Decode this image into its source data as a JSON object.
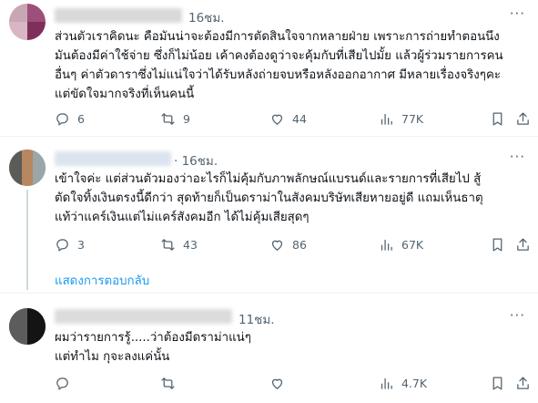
{
  "tweets": [
    {
      "time": "16ชม.",
      "more": "···",
      "lines": [
        "ส่วนตัวเราคิดนะ คือมันน่าจะต้องมีการตัดสินใจจากหลายฝ่าย เพราะการถ่ายทำตอนนึง",
        "มันต้องมีค่าใช้จ่าย ซึ่งก็ไม่น้อย เค้าคงต้องดูว่าจะคุ้มกับที่เสียไปมั้ย แล้วผู้ร่วมรายการคน",
        "อื่นๆ ค่าตัวดาราซึ่งไม่แน่ใจว่าได้รับหลังถ่ายจบหรือหลังออกอากาศ มีหลายเรื่องจริงๆคะ",
        "แต่ขัดใจมากจริงที่เห็นคนนี้"
      ],
      "replies": "6",
      "reposts": "9",
      "likes": "44",
      "views": "77K"
    },
    {
      "time": "· 16ชม.",
      "more": "···",
      "lines": [
        "เข้าใจค่ะ แต่ส่วนตัวมองว่าอะไรก็ไม่คุ้มกับภาพลักษณ์แบรนด์และรายการที่เสียไป สู้",
        "ตัดใจทิ้งเงินตรงนี้ดีกว่า สุดท้ายก็เป็นดราม่าในสังคมบริษัทเสียหายอยู่ดี แถมเห็นธาตุ",
        "แท้ว่าแคร์เงินแต่ไม่แคร์สังคมอีก ได้ไม่คุ้มเสียสุดๆ"
      ],
      "replies": "3",
      "reposts": "43",
      "likes": "86",
      "views": "67K"
    },
    {
      "time": "11ชม.",
      "more": "···",
      "lines": [
        "ผมว่ารายการรู้.....ว่าต้องมีดราม่าแน่ๆ",
        "แต่ทำไม กุจะลงแค่นั้น"
      ],
      "replies": "",
      "reposts": "",
      "likes": "",
      "views": "4.7K"
    }
  ],
  "show_replies": "แสดงการตอบกลับ",
  "icons": {
    "reply": "reply-icon",
    "repost": "repost-icon",
    "like": "heart-icon",
    "views": "views-chart-icon",
    "bookmark": "bookmark-icon",
    "share": "share-icon"
  },
  "colors": {
    "text": "#0f1419",
    "muted": "#536471",
    "link": "#1d9bf0",
    "divider": "#eff3f4",
    "thread_line": "#cfd9de"
  }
}
